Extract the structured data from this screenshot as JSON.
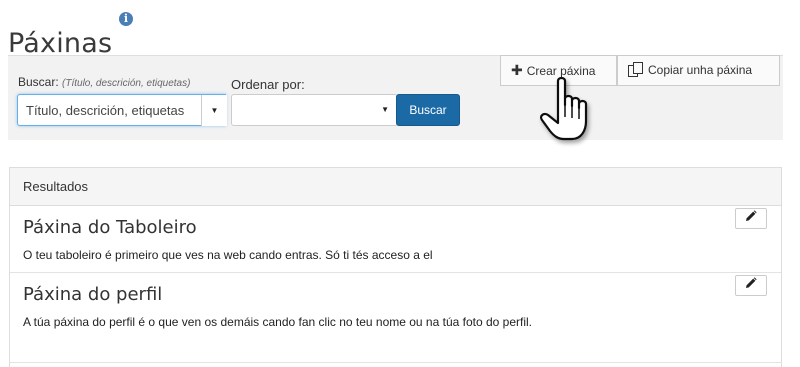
{
  "page": {
    "title": "Páxinas",
    "info_icon": "i"
  },
  "filter": {
    "search_label": "Buscar:",
    "search_hint": "(Título, descrición, etiquetas)",
    "search_placeholder": "Título, descrición, etiquetas",
    "search_value": "",
    "search_scope_caret": "▼",
    "order_label": "Ordenar por:",
    "order_value": "",
    "order_caret": "▼",
    "search_button": "Buscar"
  },
  "actions": {
    "create_icon": "plus-icon",
    "create_label": "Crear páxina",
    "copy_icon": "copy-icon",
    "copy_label": "Copiar unha páxina"
  },
  "results": {
    "header": "Resultados",
    "items": [
      {
        "title": "Páxina do Taboleiro",
        "description": "O teu taboleiro é primeiro que ves na web cando entras. Só ti tés acceso a el",
        "edit_icon": "pencil-icon"
      },
      {
        "title": "Páxina do perfil",
        "description": "A túa páxina do perfil é o que ven os demáis cando fan clic no teu nome ou na túa foto do perfil.",
        "edit_icon": "pencil-icon"
      }
    ]
  },
  "colors": {
    "primary_button": "#1b6aa5",
    "focus_border": "#66afe9",
    "panel_background": "#f2f2f2",
    "info_icon": "#4a7fb5"
  }
}
